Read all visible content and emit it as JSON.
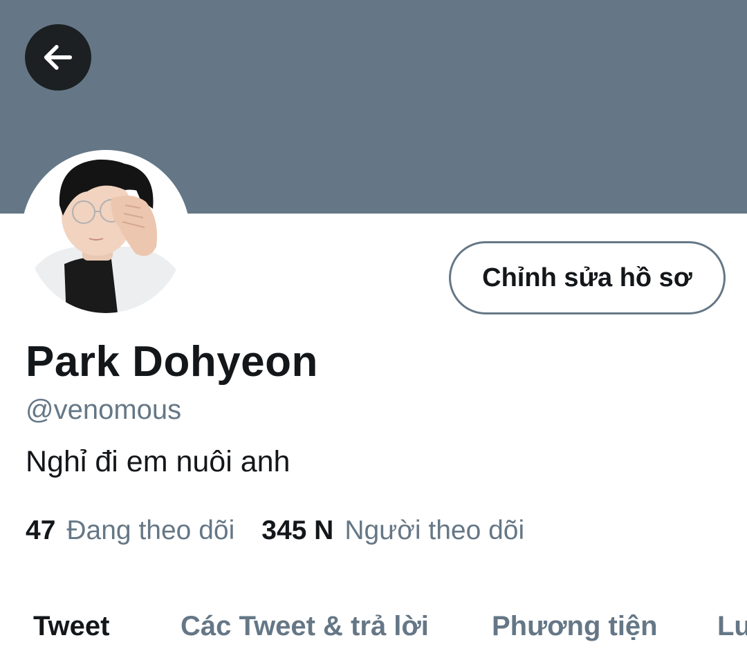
{
  "header": {
    "back_icon": "arrow-left-icon",
    "banner_color": "#657786"
  },
  "profile": {
    "edit_button_label": "Chỉnh sửa hồ sơ",
    "display_name": "Park Dohyeon",
    "handle": "@venomous",
    "bio": "Nghỉ đi em nuôi anh",
    "following_count": "47",
    "following_label": "Đang theo dõi",
    "followers_count": "345 N",
    "followers_label": "Người theo dõi"
  },
  "tabs": [
    {
      "label": "Tweet",
      "active": true
    },
    {
      "label": "Các Tweet & trả lời",
      "active": false
    },
    {
      "label": "Phương tiện",
      "active": false
    },
    {
      "label": "Lượt thích",
      "active": false
    }
  ],
  "colors": {
    "primary_text": "#14171a",
    "secondary_text": "#657786"
  }
}
